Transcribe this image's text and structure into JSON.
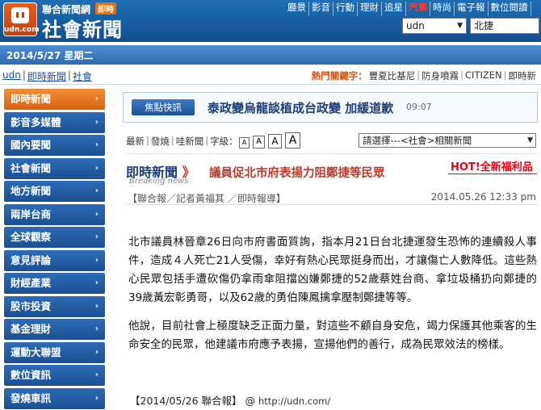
{
  "header": {
    "logo_text": "udn.com",
    "brand_small": "聯合新聞網",
    "brand_badge": "即時",
    "brand_big": "社會新聞",
    "topnav": [
      "廳景",
      "影音",
      "行動",
      "理財",
      "追星",
      "汽車",
      "時尚",
      "電子報",
      "數位閱讀"
    ],
    "topnav_hot": "汽車",
    "site_select": "udn",
    "search_value": "北捷"
  },
  "datebar": {
    "date": "2014/5/27 星期二"
  },
  "breadcrumb": {
    "items": [
      "udn",
      "即時新聞",
      "社會"
    ],
    "separator": "|"
  },
  "hot_keywords": {
    "label": "熱門關鍵字：",
    "items": [
      "豐夏比基尼",
      "防身噴霧",
      "CITIZEN",
      "即時新"
    ]
  },
  "sidebar": {
    "items": [
      {
        "label": "即時新聞",
        "active": true
      },
      {
        "label": "影音多媒體",
        "active": false
      },
      {
        "label": "國內要聞",
        "active": false
      },
      {
        "label": "社會新聞",
        "active": false
      },
      {
        "label": "地方新聞",
        "active": false
      },
      {
        "label": "兩岸台商",
        "active": false
      },
      {
        "label": "全球觀察",
        "active": false
      },
      {
        "label": "意見評論",
        "active": false
      },
      {
        "label": "財經產業",
        "active": false
      },
      {
        "label": "股市投資",
        "active": false
      },
      {
        "label": "基金理財",
        "active": false
      },
      {
        "label": "運動大聯盟",
        "active": false
      },
      {
        "label": "數位資訊",
        "active": false
      },
      {
        "label": "發燒車訊",
        "active": false
      }
    ],
    "chevron": "›",
    "active_color": "#e8751f",
    "default_color": "#2563ad"
  },
  "flash": {
    "tag": "焦點快訊",
    "title": "泰政變烏龍談植成台政變 加緩道歉",
    "time": "09:07"
  },
  "tools": {
    "links": [
      "最新",
      "發燒",
      "哇新聞"
    ],
    "fontsize_label": "字級：",
    "font_buttons": [
      "A",
      "A",
      "A",
      "A"
    ],
    "related_select": "請選擇---<社會>相關新聞"
  },
  "article": {
    "section_title": "即時新聞",
    "section_arrow": "》",
    "section_sub": "Breaking news",
    "headline": "議員促北市府表揚力阻鄭捷等民眾",
    "promo": "HOT!全新福利品",
    "byline": "【聯合報／記者黃福其 ／即時報導】",
    "date": "2014.05.26 12:33 pm",
    "paragraphs": [
      "北市議員林晉章26日向市府書面質詢，指本月21日台北捷運發生恐怖的連續殺人事件，造成４人死亡21人受傷，幸好有熱心民眾挺身而出，才讓傷亡人數降低。這些熱心民眾包括手遭砍傷仍拿雨傘阻擋凶嫌鄭捷的52歲蔡姓台商、拿垃圾桶扔向鄭捷的39歲黃宏彰勇哥，以及62歲的勇伯陳鳳擒拿壓制鄭捷等等。",
      "他說，目前社會上極度缺乏正面力量，對這些不顧自身安危，竭力保護其他乘客的生命安全的民眾，他建議市府應予表揚，宣揚他們的善行，成為民眾效法的榜樣。"
    ],
    "source": "【2014/05/26 聯合報】",
    "source_at": "@",
    "source_url": "http://udn.com/"
  }
}
